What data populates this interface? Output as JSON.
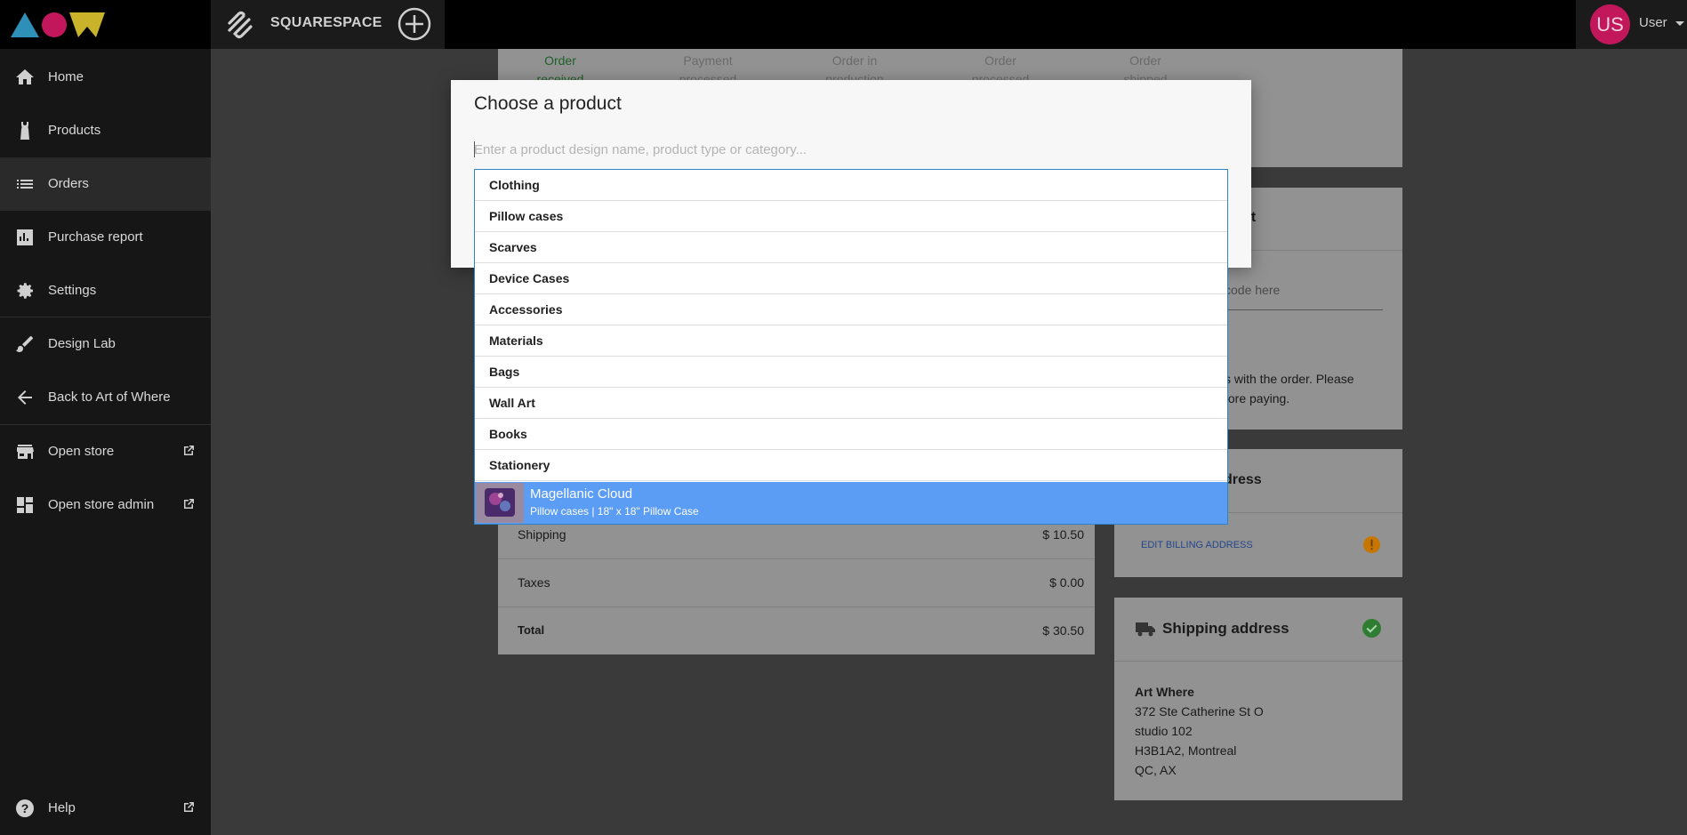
{
  "topbar": {
    "brand_text": "SQUARESPACE",
    "user_initials": "US",
    "user_name": "User"
  },
  "sidebar": {
    "items": [
      {
        "label": "Home",
        "icon": "home-icon"
      },
      {
        "label": "Products",
        "icon": "tank-top-icon"
      },
      {
        "label": "Orders",
        "icon": "list-icon",
        "active": true
      },
      {
        "label": "Purchase report",
        "icon": "bar-chart-icon"
      },
      {
        "label": "Settings",
        "icon": "gear-icon"
      },
      {
        "label": "Design Lab",
        "icon": "brush-icon"
      },
      {
        "label": "Back to Art of Where",
        "icon": "arrow-back-icon"
      },
      {
        "label": "Open store",
        "icon": "store-icon"
      },
      {
        "label": "Open store admin",
        "icon": "dashboard-icon"
      },
      {
        "label": "Help",
        "icon": "help-icon"
      }
    ]
  },
  "background": {
    "steps": [
      {
        "line1": "Order",
        "line2": "received"
      },
      {
        "line1": "Payment",
        "line2": "processed"
      },
      {
        "line1": "Order in",
        "line2": "production"
      },
      {
        "line1": "Order",
        "line2": "processed"
      },
      {
        "line1": "Order",
        "line2": "shipped"
      }
    ],
    "totals": [
      {
        "label": "Shipping",
        "value": "$ 10.50"
      },
      {
        "label": "Taxes",
        "value": "$ 0.00"
      },
      {
        "label": "Total",
        "value": "$ 30.50"
      }
    ],
    "payment_title_partial": "ment",
    "promo_placeholder_partial": "code here",
    "payment_note_line1": "s with the order. Please",
    "payment_note_line2": "fore paying.",
    "billing_title_partial": "dress",
    "edit_billing": "EDIT BILLING ADDRESS",
    "shipping_title": "Shipping address",
    "address": {
      "name": "Art Where",
      "line1": "372 Ste Catherine St O",
      "line2": "studio 102",
      "line3": "H3B1A2, Montreal",
      "line4": "QC, AX"
    }
  },
  "modal": {
    "title": "Choose a product",
    "search_placeholder": "Enter a product design name, product type or category...",
    "categories": [
      "Clothing",
      "Pillow cases",
      "Scarves",
      "Device Cases",
      "Accessories",
      "Materials",
      "Bags",
      "Wall Art",
      "Books",
      "Stationery"
    ],
    "suggestion": {
      "name": "Magellanic Cloud",
      "detail": "Pillow cases | 18\" x 18\" Pillow Case"
    }
  },
  "colors": {
    "accent_blue": "#5b9cf4",
    "focus_border": "#2a86c9",
    "avatar": "#c2185b",
    "success": "#2e7d32",
    "warning": "#c77700"
  }
}
